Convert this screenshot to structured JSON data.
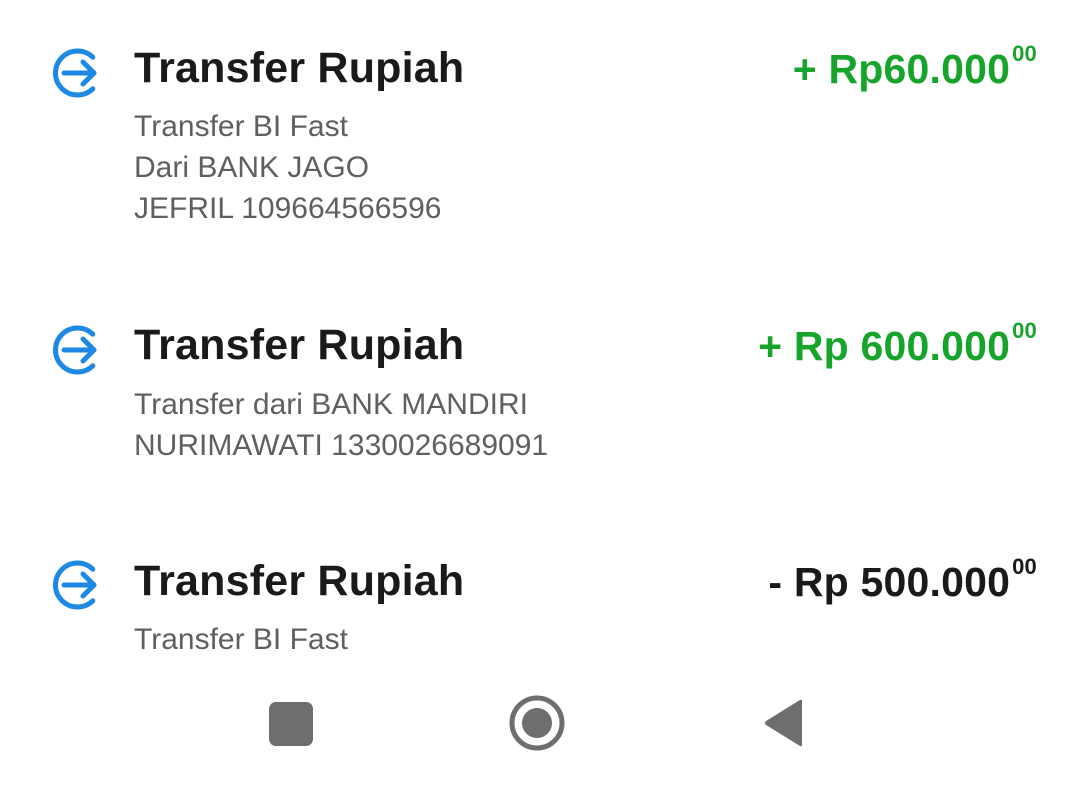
{
  "transactions": [
    {
      "icon": "transfer-in-arrow-icon",
      "title": "Transfer Rupiah",
      "amount_main": "+ Rp60.000",
      "amount_cents": "00",
      "direction": "credit",
      "lines": [
        "Transfer BI Fast",
        "Dari BANK JAGO",
        "JEFRIL 109664566596"
      ]
    },
    {
      "icon": "transfer-in-arrow-icon",
      "title": "Transfer Rupiah",
      "amount_main": "+ Rp 600.000",
      "amount_cents": "00",
      "direction": "credit",
      "lines": [
        "Transfer dari BANK MANDIRI",
        "NURIMAWATI 1330026689091"
      ]
    },
    {
      "icon": "transfer-in-arrow-icon",
      "title": "Transfer Rupiah",
      "amount_main": "- Rp 500.000",
      "amount_cents": "00",
      "direction": "debit",
      "lines": [
        "Transfer BI Fast"
      ]
    }
  ],
  "colors": {
    "credit_amount": "#17a42b",
    "debit_amount": "#1a1a1a",
    "icon_blue": "#1e88e5",
    "nav_gray": "#6e6e6e"
  },
  "navbar": {
    "recents_icon": "recents-square-icon",
    "home_icon": "home-circle-icon",
    "back_icon": "back-triangle-icon"
  }
}
